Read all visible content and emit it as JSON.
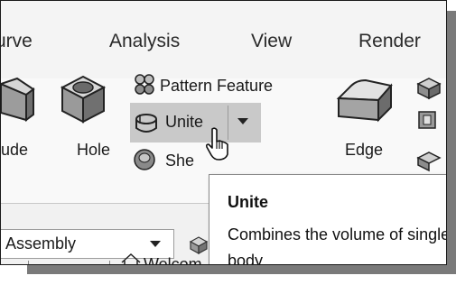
{
  "menubar": {
    "items": [
      "urve",
      "Analysis",
      "View",
      "Render"
    ]
  },
  "ribbon": {
    "extrude_label": "ude",
    "hole_label": "Hole",
    "pattern_feature_label": "Pattern Feature",
    "unite_label": "Unite",
    "shell_label": "She",
    "edge_blend_label": "Edge"
  },
  "toolbar2": {
    "dropdown_value": "Assembly",
    "tab_label": "Welcom"
  },
  "tooltip": {
    "title": "Unite",
    "description": "Combines the volume of single body."
  }
}
